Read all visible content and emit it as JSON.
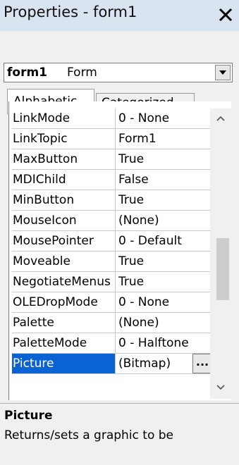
{
  "window": {
    "title": "Properties - form1",
    "close_icon": "close-x-icon"
  },
  "object_selector": {
    "name": "form1",
    "type": "Form"
  },
  "tabs": [
    {
      "label": "Alphabetic",
      "active": true
    },
    {
      "label": "Categorized",
      "active": false
    }
  ],
  "properties": [
    {
      "name": "LinkMode",
      "value": "0 - None"
    },
    {
      "name": "LinkTopic",
      "value": "Form1"
    },
    {
      "name": "MaxButton",
      "value": "True"
    },
    {
      "name": "MDIChild",
      "value": "False"
    },
    {
      "name": "MinButton",
      "value": "True"
    },
    {
      "name": "MouseIcon",
      "value": "(None)"
    },
    {
      "name": "MousePointer",
      "value": "0 - Default"
    },
    {
      "name": "Moveable",
      "value": "True"
    },
    {
      "name": "NegotiateMenus",
      "value": "True"
    },
    {
      "name": "OLEDropMode",
      "value": "0 - None"
    },
    {
      "name": "Palette",
      "value": "(None)"
    },
    {
      "name": "PaletteMode",
      "value": "0 - Halftone"
    },
    {
      "name": "Picture",
      "value": "(Bitmap)",
      "selected": true,
      "button_label": "..."
    }
  ],
  "description": {
    "title": "Picture",
    "text": "Returns/sets a graphic to be"
  },
  "colors": {
    "selection": "#0a62d3",
    "titlebar": "#d9e4f1"
  }
}
